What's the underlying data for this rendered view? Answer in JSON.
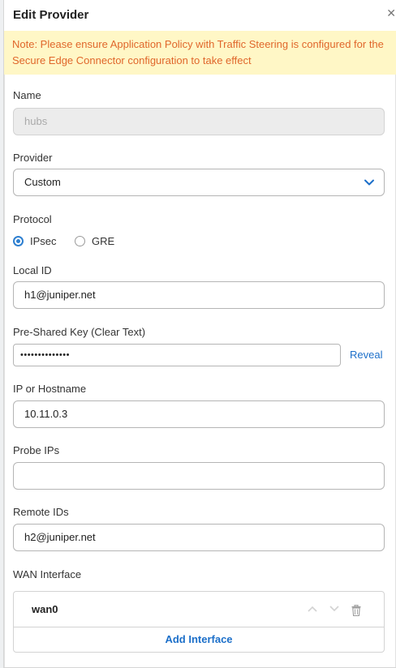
{
  "dialog": {
    "title": "Edit Provider"
  },
  "notice": {
    "text": "Note: Please ensure Application Policy with Traffic Steering is configured for the Secure Edge Connector configuration to take effect"
  },
  "form": {
    "name_label": "Name",
    "name_value": "hubs",
    "provider_label": "Provider",
    "provider_value": "Custom",
    "protocol_label": "Protocol",
    "protocol_options": [
      "IPsec",
      "GRE"
    ],
    "protocol_selected": "IPsec",
    "local_id_label": "Local ID",
    "local_id_value": "h1@juniper.net",
    "psk_label": "Pre-Shared Key (Clear Text)",
    "psk_value": "••••••••••••••",
    "reveal_label": "Reveal",
    "ip_label": "IP or Hostname",
    "ip_value": "10.11.0.3",
    "probe_label": "Probe IPs",
    "probe_value": "",
    "remote_label": "Remote IDs",
    "remote_value": "h2@juniper.net",
    "wan_label": "WAN Interface",
    "wan_items": [
      "wan0"
    ],
    "add_interface_label": "Add Interface"
  },
  "colors": {
    "accent": "#1c6fc9",
    "notice_bg": "#fff7c6",
    "notice_text": "#e0672b"
  },
  "icons": {
    "close": "close-icon",
    "dropdown": "chevron-down-icon",
    "delete": "trash-icon"
  }
}
